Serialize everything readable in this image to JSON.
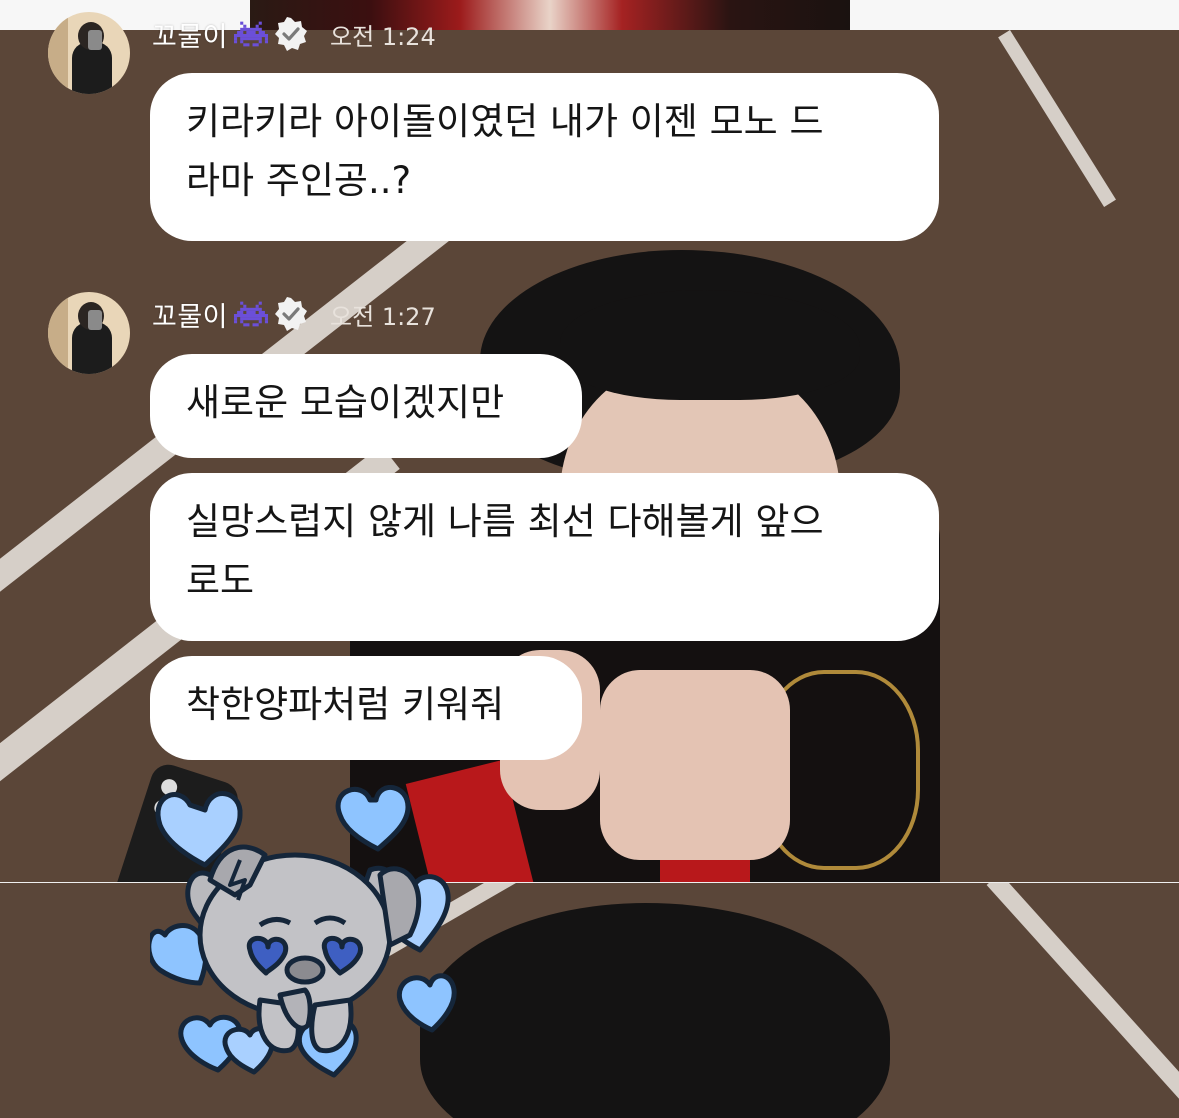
{
  "messages": [
    {
      "sender": "꼬물이",
      "time": "오전 1:24",
      "bubbles": [
        "키라키라 아이돌이였던 내가 이젠 모노 드\n라마 주인공..?"
      ]
    },
    {
      "sender": "꼬물이",
      "time": "오전 1:27",
      "bubbles": [
        "새로운 모습이겠지만",
        "실망스럽지 않게 나름 최선 다해볼게 앞으\n로도",
        "착한양파처럼 키워줘"
      ]
    }
  ],
  "colors": {
    "bubble_bg": "#ffffff",
    "sticker_hearts": "#8ec4ff",
    "sticker_dog": "#b9b9bd"
  }
}
